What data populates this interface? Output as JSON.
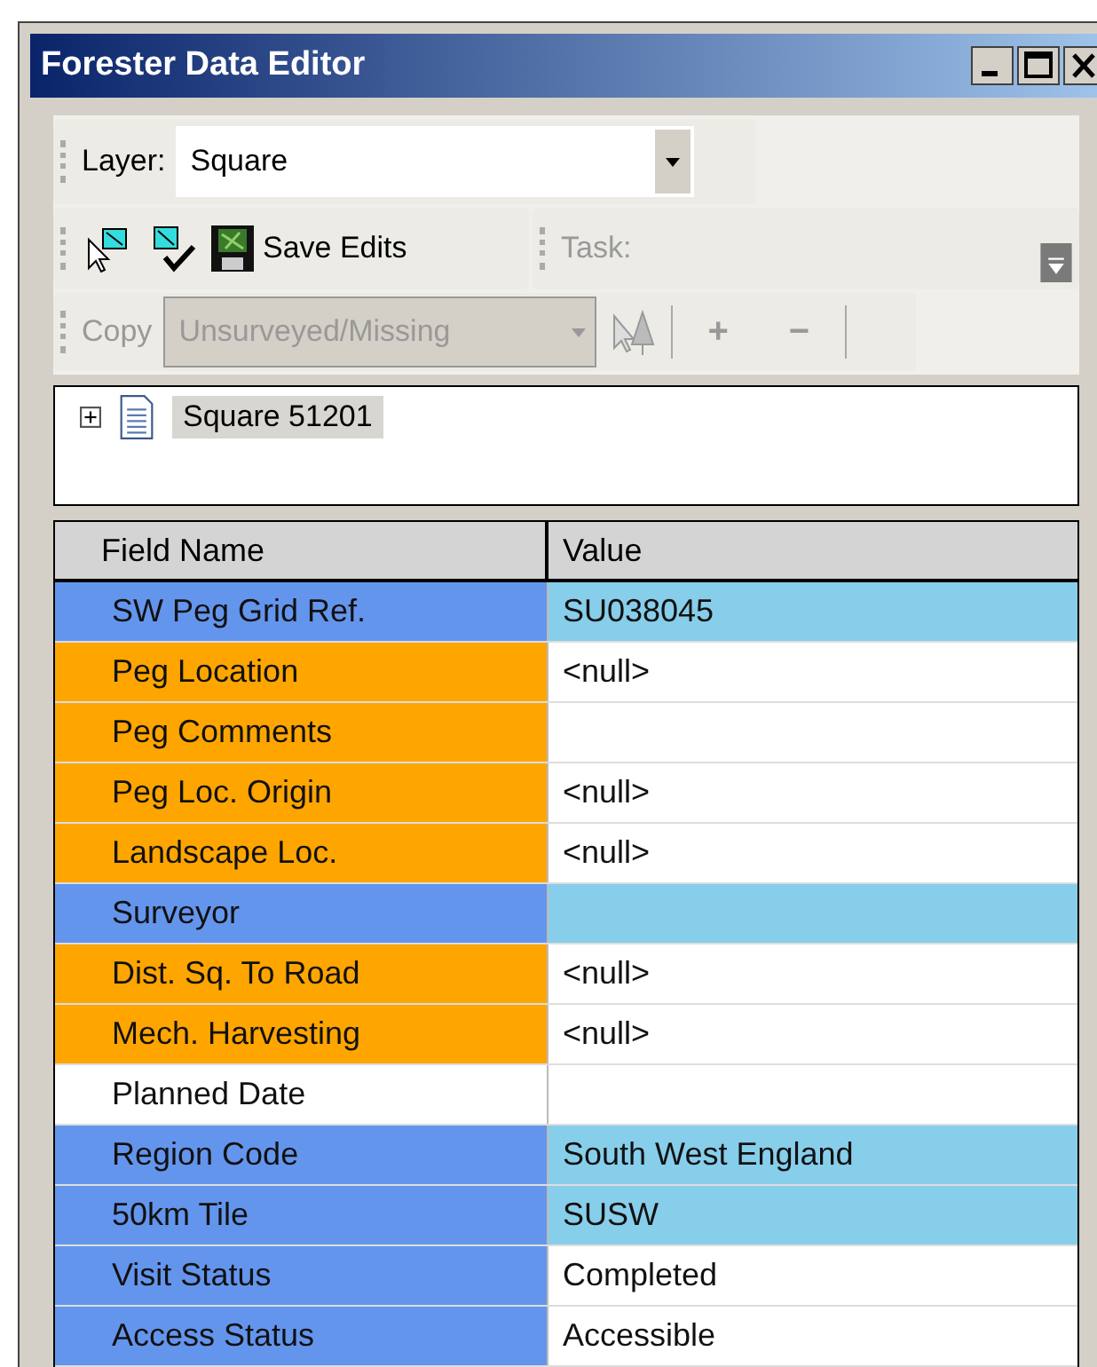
{
  "window": {
    "title": "Forester Data Editor"
  },
  "layer_toolbar": {
    "label": "Layer:",
    "value": "Square"
  },
  "edit_toolbar": {
    "save_label": "Save Edits",
    "task_label": "Task:",
    "task_disabled": true
  },
  "copy_toolbar": {
    "copy_label": "Copy",
    "copy_disabled": true,
    "value": "Unsurveyed/Missing",
    "plus": "+",
    "minus": "−"
  },
  "tree": {
    "items": [
      {
        "label": "Square 51201",
        "expanded": false,
        "selected": true
      }
    ]
  },
  "table": {
    "columns": [
      "Field Name",
      "Value"
    ],
    "rows": [
      {
        "name": "SW Peg Grid Ref.",
        "color": "#6495ed",
        "value": {
          "text": "SU038045",
          "color": "#87ceeb"
        }
      },
      {
        "name": "Peg Location",
        "color": "#ffa500",
        "value": {
          "text": "<null>",
          "color": "#ffffff"
        }
      },
      {
        "name": "Peg Comments",
        "color": "#ffa500",
        "value": {
          "color": "#ffffff"
        }
      },
      {
        "name": "Peg Loc. Origin",
        "color": "#ffa500",
        "value": {
          "text": "<null>",
          "color": "#ffffff"
        }
      },
      {
        "name": "Landscape Loc.",
        "color": "#ffa500",
        "value": {
          "text": "<null>",
          "color": "#ffffff"
        }
      },
      {
        "name": "Surveyor",
        "color": "#6495ed",
        "value": {
          "color": "#87ceeb"
        }
      },
      {
        "name": "Dist. Sq. To Road",
        "color": "#ffa500",
        "value": {
          "text": "<null>",
          "color": "#ffffff"
        }
      },
      {
        "name": "Mech. Harvesting",
        "color": "#ffa500",
        "value": {
          "text": "<null>",
          "color": "#ffffff"
        }
      },
      {
        "name": "Planned Date",
        "color": "#ffffff",
        "value": {
          "color": "#ffffff"
        }
      },
      {
        "name": "Region Code",
        "color": "#6495ed",
        "value": {
          "text": "South West England",
          "color": "#87ceeb"
        }
      },
      {
        "name": "50km Tile",
        "color": "#6495ed",
        "value": {
          "text": "SUSW",
          "color": "#87ceeb"
        }
      },
      {
        "name": "Visit Status",
        "color": "#6495ed",
        "value": {
          "text": "Completed",
          "color": "#ffffff"
        }
      },
      {
        "name": "Access Status",
        "color": "#6495ed",
        "value": {
          "text": "Accessible",
          "color": "#ffffff"
        }
      }
    ]
  }
}
